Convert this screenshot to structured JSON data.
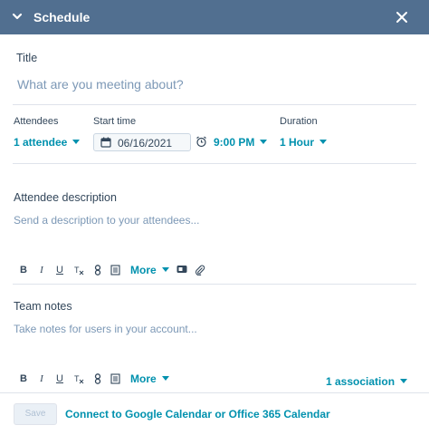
{
  "header": {
    "title": "Schedule"
  },
  "title_field": {
    "label": "Title",
    "placeholder": "What are you meeting about?"
  },
  "attendees": {
    "label": "Attendees",
    "value": "1 attendee"
  },
  "start_time": {
    "label": "Start time",
    "date": "06/16/2021",
    "time": "9:00 PM"
  },
  "duration": {
    "label": "Duration",
    "value": "1 Hour"
  },
  "attendee_description": {
    "label": "Attendee description",
    "placeholder": "Send a description to your attendees..."
  },
  "team_notes": {
    "label": "Team notes",
    "placeholder": "Take notes for users in your account..."
  },
  "toolbar": {
    "bold": "B",
    "italic": "I",
    "underline": "U",
    "more": "More"
  },
  "association": {
    "label": "1 association"
  },
  "footer": {
    "save": "Save",
    "connect": "Connect to Google Calendar or Office 365 Calendar"
  },
  "colors": {
    "header_bg": "#516f90",
    "link": "#0091ae",
    "text": "#33475b",
    "placeholder": "#7c98b6"
  },
  "icons": [
    "chevron-down-icon",
    "close-icon",
    "calendar-icon",
    "clock-icon",
    "bold-icon",
    "italic-icon",
    "underline-icon",
    "clear-format-icon",
    "link-icon",
    "snippet-icon",
    "video-icon",
    "attachment-icon"
  ]
}
